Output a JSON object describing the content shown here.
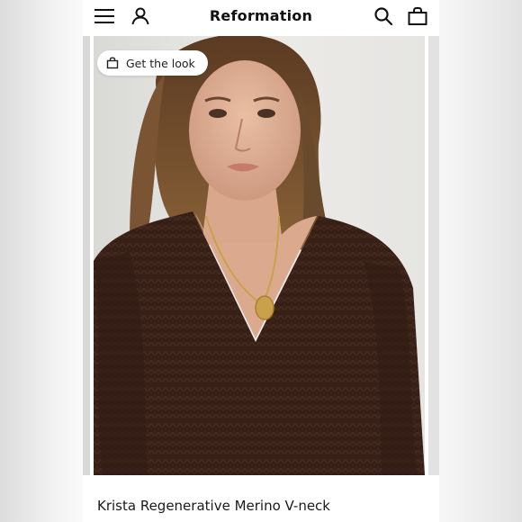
{
  "header": {
    "brand": "Reformation",
    "icons": {
      "menu": "hamburger-menu-icon",
      "account": "user-icon",
      "search": "search-icon",
      "bag": "shopping-bag-icon"
    }
  },
  "hero": {
    "get_the_look_label": "Get the look",
    "get_the_look_icon": "shopping-bag-icon",
    "image_subject": "model wearing brown knit V-neck sweater with gold pendant necklace"
  },
  "product": {
    "title": "Krista Regenerative Merino V-neck"
  },
  "colors": {
    "sweater": "#3a2219",
    "background": "#e4e4e2",
    "text": "#1a1a1a"
  }
}
